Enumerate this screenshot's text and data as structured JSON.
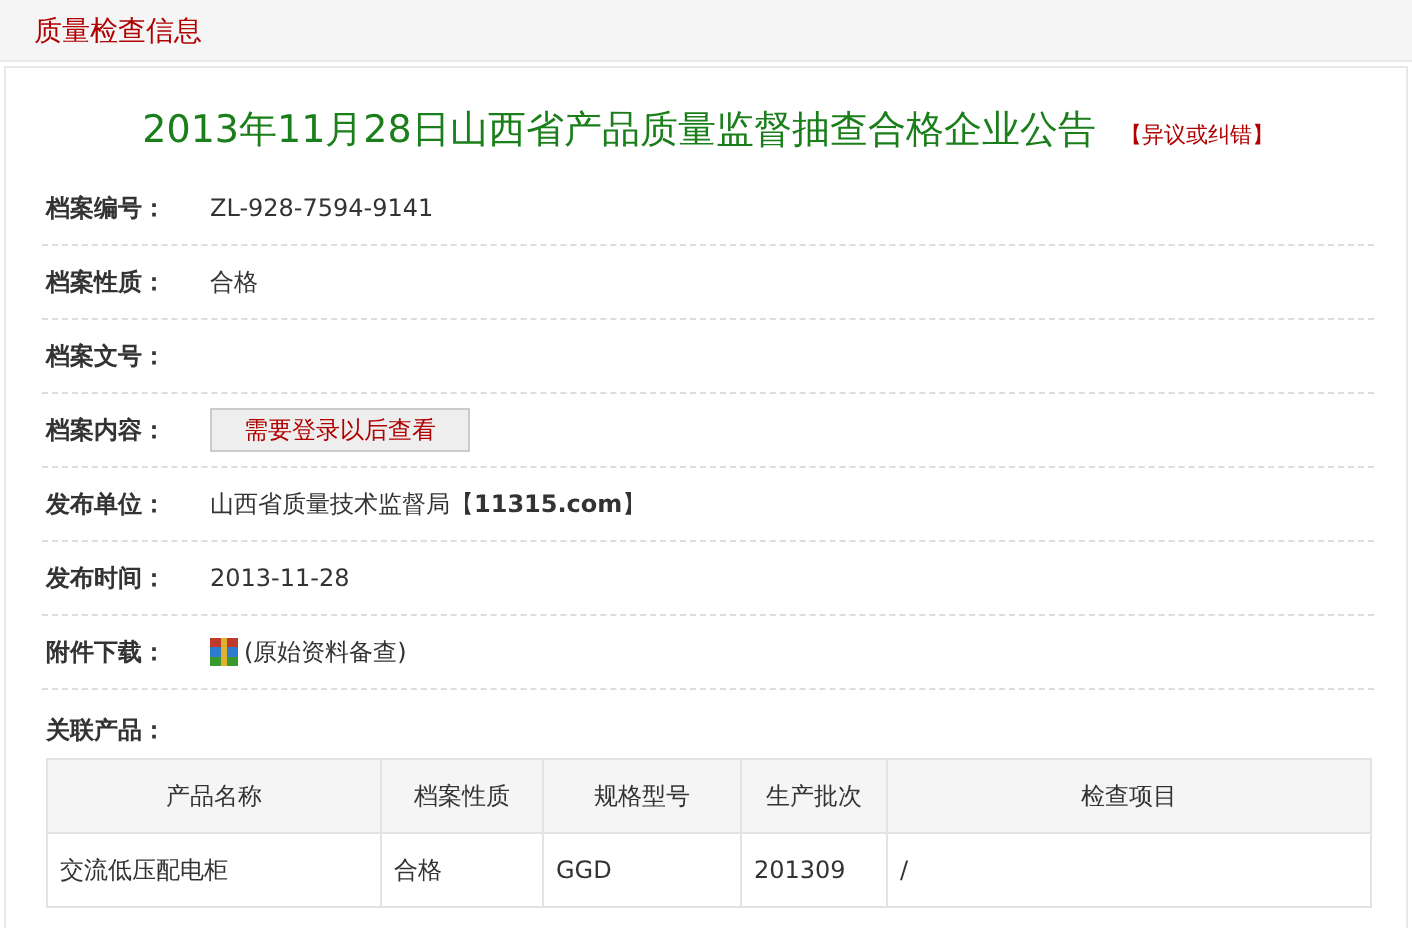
{
  "header": {
    "title": "质量检查信息"
  },
  "notice": {
    "title": "2013年11月28日山西省产品质量监督抽查合格企业公告",
    "link": "【异议或纠错】"
  },
  "fields": [
    {
      "kind": "text",
      "label": "档案编号：",
      "value": "ZL-928-7594-9141"
    },
    {
      "kind": "text",
      "label": "档案性质：",
      "value": "合格"
    },
    {
      "label": "档案文号："
    },
    {
      "kind": "button",
      "label": "档案内容：",
      "value": "需要登录以后查看"
    },
    {
      "kind": "text",
      "label": "发布单位：",
      "value": "山西省质量技术监督局【**11315.com**】"
    },
    {
      "kind": "text",
      "label": "发布时间：",
      "value": "2013-11-28"
    },
    {
      "kind": "attachment",
      "label": "附件下载：",
      "value": "(原始资料备查)"
    }
  ],
  "products": {
    "label": "关联产品：",
    "columns": [
      "产品名称",
      "档案性质",
      "规格型号",
      "生产批次",
      "检查项目"
    ],
    "rows": [
      [
        "交流低压配电柜",
        "合格",
        "GGD",
        "201309",
        "/"
      ]
    ]
  }
}
